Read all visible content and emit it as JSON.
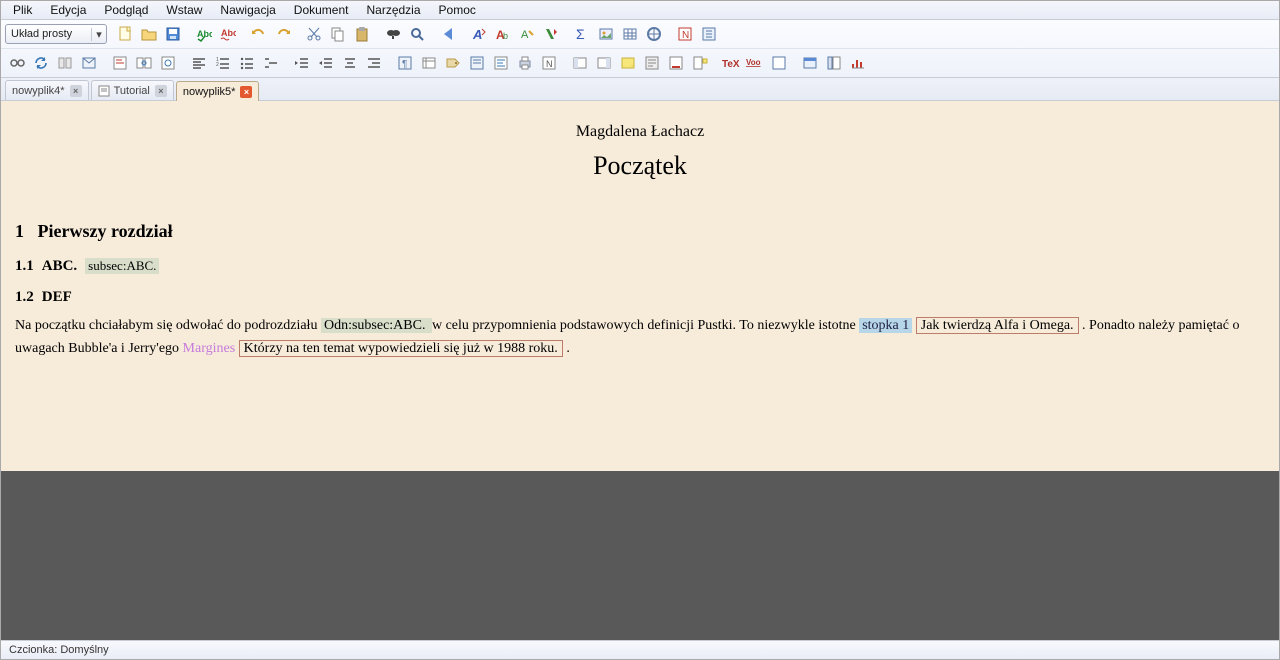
{
  "menu": [
    "Plik",
    "Edycja",
    "Podgląd",
    "Wstaw",
    "Nawigacja",
    "Dokument",
    "Narzędzia",
    "Pomoc"
  ],
  "combo": {
    "value": "Układ prosty"
  },
  "tabs": [
    {
      "label": "nowyplik4*",
      "close": "gray",
      "icon": false,
      "active": false
    },
    {
      "label": "Tutorial",
      "close": "gray",
      "icon": true,
      "active": false
    },
    {
      "label": "nowyplik5*",
      "close": "red",
      "icon": false,
      "active": true
    }
  ],
  "doc": {
    "author": "Magdalena Łachacz",
    "title": "Początek",
    "sec1_num": "1",
    "sec1_title": "Pierwszy rozdział",
    "sub11_num": "1.1",
    "sub11_title": "ABC.",
    "sub11_label": "subsec:ABC.",
    "sub12_num": "1.2",
    "sub12_title": "DEF",
    "p1_a": "Na początku chciałabym się odwołać do podrozdziału ",
    "p1_ref": " Odn:subsec:ABC. ",
    "p1_b": " w celu przypomnienia podstawowych definicji Pustki. To niezwykle istotne ",
    "p1_fn": "stopka 1",
    "p1_note1": "Jak twierdzą Alfa i Omega.",
    "p1_c": ". Ponadto należy pamiętać o uwagach Bubble'a i Jerry'ego ",
    "p1_margin": "Margines",
    "p1_note2": "Którzy na ten temat wypowiedzieli się już w 1988 roku.",
    "p1_d": "."
  },
  "status": "Czcionka: Domyślny"
}
